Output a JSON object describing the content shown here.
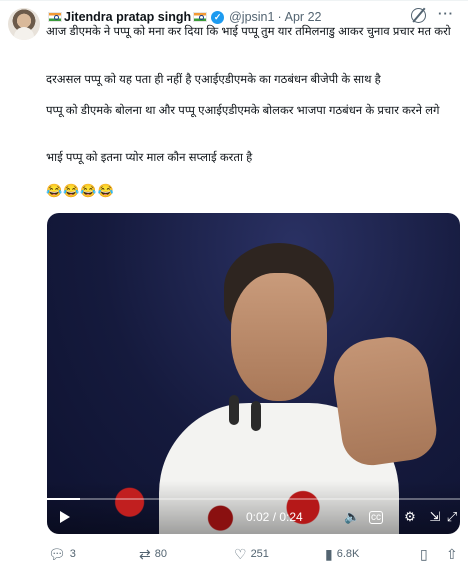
{
  "author": {
    "name": "Jitendra pratap singh",
    "handle": "@jpsin1",
    "date": "Apr 22"
  },
  "tweet": {
    "line1": "आज डीएमके ने पप्पू को मना कर दिया कि भाई पप्पू तुम यार तमिलनाडु आकर चुनाव प्रचार मत करो",
    "line2": "दरअसल पप्पू को यह पता ही नहीं है एआईएडीएमके का गठबंधन बीजेपी के साथ है",
    "line3": "पप्पू को डीएमके बोलना था और पप्पू एआईएडीएमके बोलकर भाजपा गठबंधन के प्रचार करने लगे",
    "line4": "भाई पप्पू को इतना प्योर माल कौन सप्लाई करता है",
    "emoji": "😂😂😂😂"
  },
  "video": {
    "time": "0:02 / 0:24",
    "progress": 0.08
  },
  "actions": {
    "replies": "3",
    "retweets": "80",
    "likes": "251",
    "views": "6.8K"
  },
  "colors": {
    "accent": "#1d9bf0",
    "muted": "#536471",
    "text": "#0f1419"
  },
  "icons": {
    "verified": "verified-badge-icon",
    "grok": "grok-icon",
    "more": "more-icon",
    "reply": "reply-icon",
    "retweet": "retweet-icon",
    "like": "heart-icon",
    "views": "views-icon",
    "bookmark": "bookmark-icon",
    "share": "share-icon"
  }
}
